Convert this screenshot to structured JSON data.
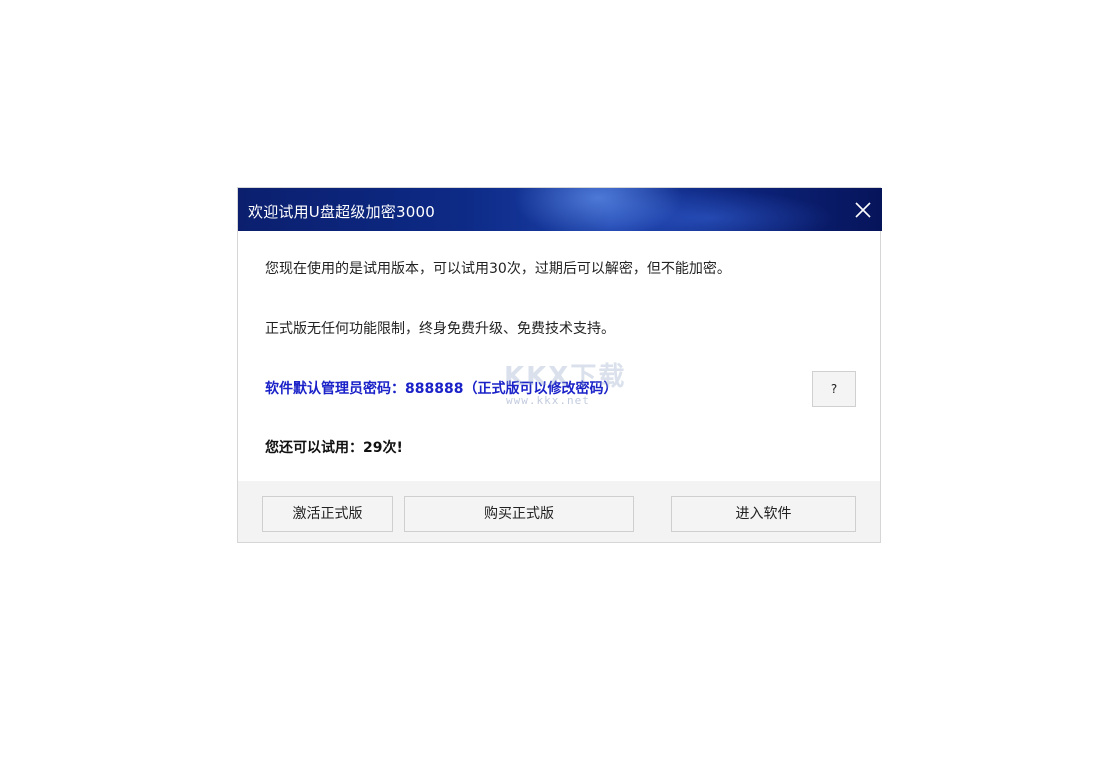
{
  "window": {
    "title": "欢迎试用U盘超级加密3000",
    "close_icon": "close-icon"
  },
  "content": {
    "trial_notice": "您现在使用的是试用版本，可以试用30次，过期后可以解密，但不能加密。",
    "full_version_info": "正式版无任何功能限制，终身免费升级、免费技术支持。",
    "default_password": "软件默认管理员密码：888888（正式版可以修改密码）",
    "remaining_trials": "您还可以试用：29次!",
    "help_label": "?"
  },
  "watermark": {
    "logo": "KKX下载",
    "url": "www.kkx.net"
  },
  "footer": {
    "activate_label": "激活正式版",
    "buy_label": "购买正式版",
    "enter_label": "进入软件"
  },
  "colors": {
    "title_bar": "#0d2a86",
    "password_text": "#1a22c8",
    "footer_bg": "#f3f3f3"
  }
}
